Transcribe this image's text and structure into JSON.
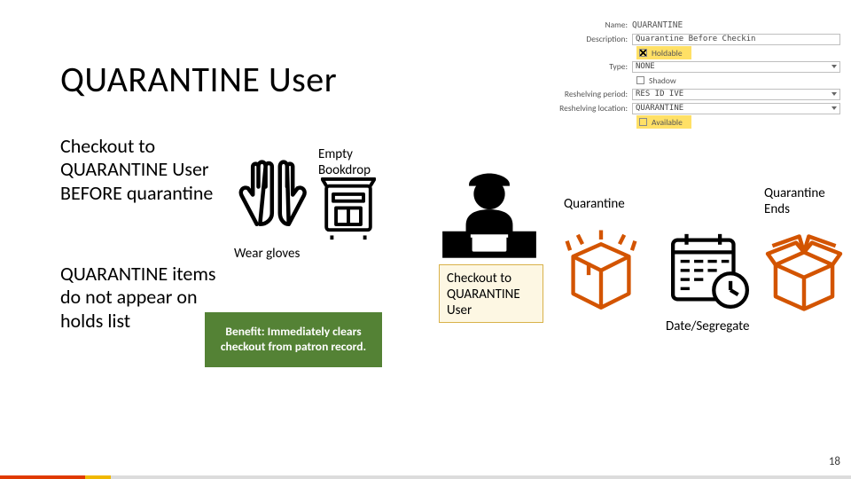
{
  "title": "QUARANTINE User",
  "sub1": "Checkout to QUARANTINE User BEFORE quarantine",
  "sub2": "QUARANTINE items do not appear on holds list",
  "labels": {
    "empty": "Empty\nBookdrop",
    "wear": "Wear gloves",
    "quarantine": "Quarantine",
    "quarantine_ends": "Quarantine\nEnds",
    "date_segregate": "Date/Segregate"
  },
  "benefit": "Benefit: Immediately clears checkout from patron record.",
  "checkout_box": "Checkout to QUARANTINE User",
  "page_number": "18",
  "panel": {
    "name_key": "Name:",
    "name_val": "QUARANTINE",
    "desc_key": "Description:",
    "desc_val": "Quarantine Before Checkin",
    "holdable": "Holdable",
    "type_key": "Type:",
    "type_val": "NONE",
    "shadow": "Shadow",
    "reshelv_key": "Reshelving period:",
    "reshelv_val": "RES ID IVE",
    "reloc_key": "Reshelving location:",
    "reloc_val": "QUARANTINE",
    "available": "Available"
  }
}
